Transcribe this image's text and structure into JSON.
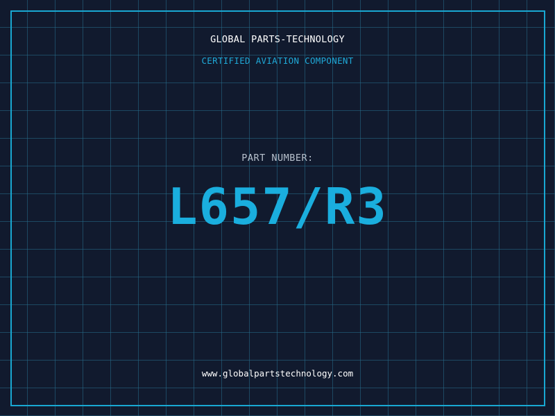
{
  "header": {
    "brand": "GLOBAL PARTS-TECHNOLOGY",
    "subtitle": "CERTIFIED AVIATION COMPONENT"
  },
  "part": {
    "label": "PART NUMBER:",
    "number": "L657/R3"
  },
  "footer": {
    "url": "www.globalpartstechnology.com"
  },
  "colors": {
    "background": "#111a2e",
    "grid": "#266e8c",
    "accent": "#1aaede",
    "border": "#19a8d2"
  }
}
